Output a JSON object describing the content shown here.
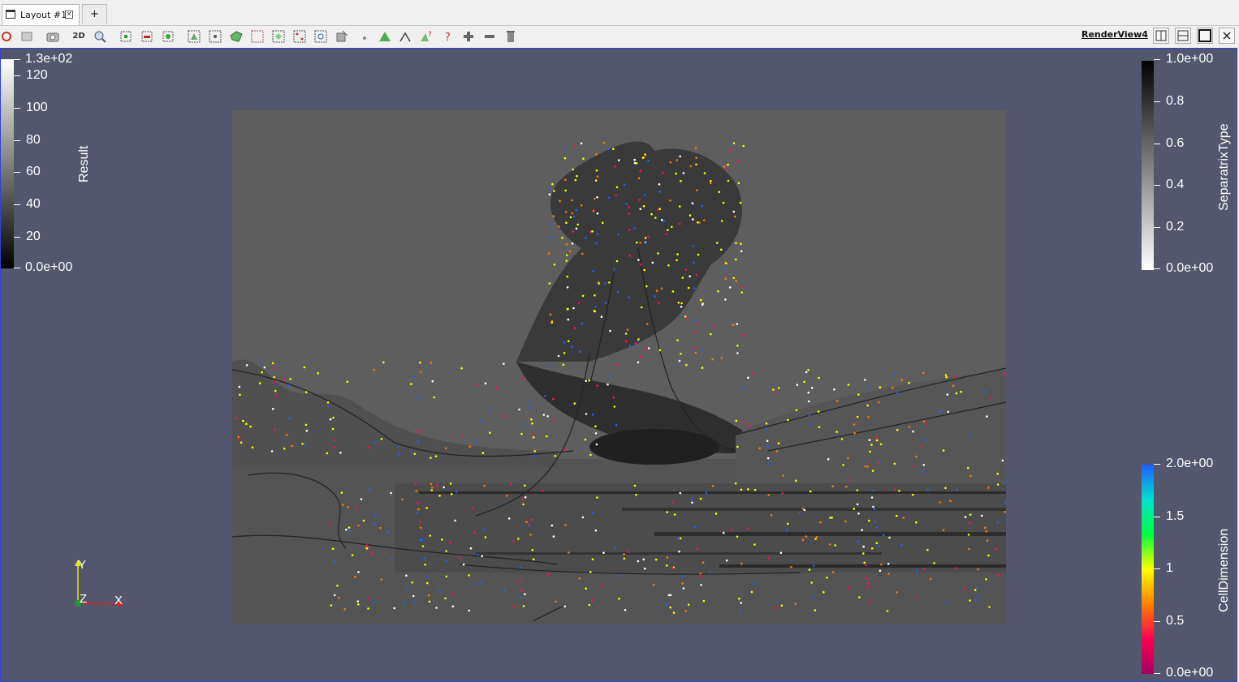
{
  "tab": {
    "label": "Layout #1",
    "new_tab": "+"
  },
  "toolbar": {
    "mode_2d": "2D",
    "render_view_label": "RenderView4"
  },
  "colorbars": {
    "result": {
      "title": "Result",
      "labels": [
        "1.3e+02",
        "120",
        "100",
        "80",
        "60",
        "40",
        "20",
        "0.0e+00"
      ],
      "colors": [
        "#ffffff",
        "#000000"
      ]
    },
    "separatrix": {
      "title": "SeparatrixType",
      "labels": [
        "1.0e+00",
        "0.8",
        "0.6",
        "0.4",
        "0.2",
        "0.0e+00"
      ],
      "colors": [
        "#000000",
        "#ffffff"
      ]
    },
    "celldimension": {
      "title": "CellDimension",
      "labels": [
        "2.0e+00",
        "1.5",
        "1",
        "0.5",
        "0.0e+00"
      ],
      "colors": [
        "#1f5fff",
        "#00e0d0",
        "#00ff40",
        "#ffff00",
        "#ff8000",
        "#ff0050",
        "#a00060"
      ]
    }
  },
  "orientation_axes": {
    "y": "Y",
    "z": "Z",
    "x": "X"
  },
  "colors": {
    "view_background": "#52576e",
    "view_border": "#2f45c8",
    "scene_background": "#5e5e5e"
  }
}
